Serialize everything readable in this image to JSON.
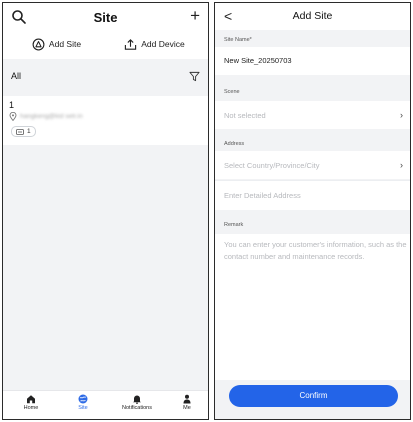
{
  "site_list": {
    "header": {
      "title": "Site",
      "add_symbol": "+"
    },
    "actions": {
      "add_site": "Add Site",
      "add_device": "Add Device"
    },
    "filter_label": "All",
    "sites": [
      {
        "name": "1",
        "location": "hangkeng@kid setr.in",
        "device_count": "1"
      }
    ],
    "tabs": [
      {
        "label": "Home",
        "icon": "home-icon"
      },
      {
        "label": "Site",
        "icon": "globe-icon",
        "active": true
      },
      {
        "label": "Notifications",
        "icon": "bell-icon"
      },
      {
        "label": "Me",
        "icon": "person-icon"
      }
    ],
    "accent_color": "#2e6be6"
  },
  "add_site": {
    "header": {
      "title": "Add Site",
      "back_symbol": "<"
    },
    "site_name": {
      "label": "Site Name*",
      "value": "New Site_20250703"
    },
    "scene": {
      "label": "Scene",
      "placeholder": "Not selected"
    },
    "address": {
      "label": "Address",
      "region_placeholder": "Select Country/Province/City",
      "detail_placeholder": "Enter Detailed Address"
    },
    "remark": {
      "label": "Remark",
      "placeholder": "You can enter your customer's information, such as the contact number and maintenance records."
    },
    "confirm_label": "Confirm",
    "confirm_color": "#2364e8"
  }
}
